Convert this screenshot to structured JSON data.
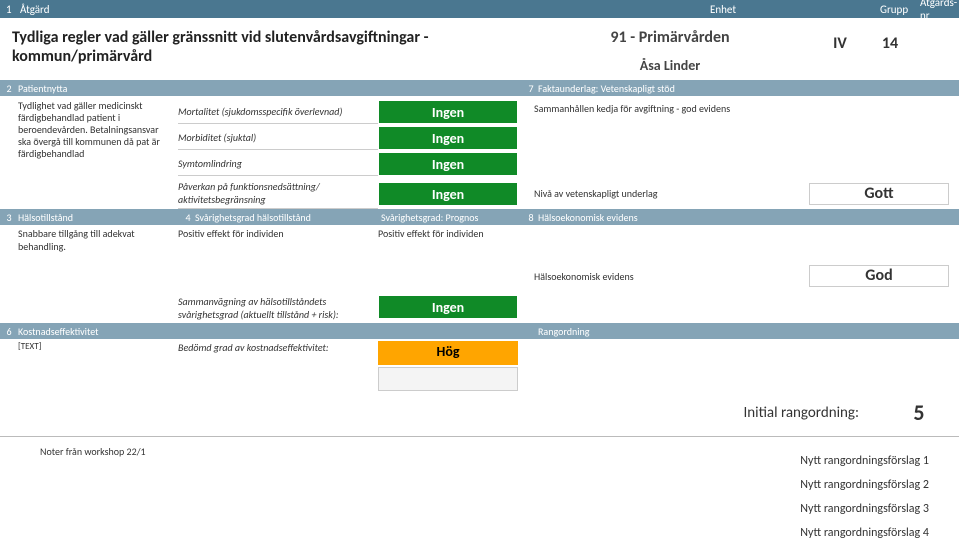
{
  "header": {
    "num": "1",
    "atgard": "Åtgärd",
    "enhet": "Enhet",
    "grupp": "Grupp",
    "atgardsnr": "Åtgärds-nr"
  },
  "title": "Tydliga regler vad gäller gränssnitt vid slutenvårdsavgiftningar - kommun/primärvård",
  "unit": {
    "code_title": "91 - Primärvården",
    "owner": "Åsa Linder",
    "grupp": "IV",
    "nr": "14"
  },
  "bar2": {
    "num": "2",
    "label": "Patientnytta",
    "num7": "7",
    "label7": "Faktaunderlag: Vetenskapligt stöd"
  },
  "sec2": {
    "desc": "Tydlighet vad gäller medicinskt färdigbehandlad patient i beroendevården. Betalningsansvar ska övergå till kommunen då pat är färdigbehandlad",
    "m1": "Mortalitet (sjukdomsspecifik överlevnad)",
    "m2": "Morbiditet (sjuktal)",
    "m3": "Symtomlindring",
    "b1": "Ingen",
    "b2": "Ingen",
    "b3": "Ingen",
    "evidens": "Sammanhållen kedja för avgiftning - god evidens"
  },
  "m4": {
    "label": "Påverkan på funktionsnedsättning/ aktivitetsbegränsning",
    "badge": "Ingen",
    "right_label": "Nivå av vetenskapligt underlag",
    "gott": "Gott"
  },
  "bar3": {
    "num": "3",
    "label": "Hälsotillstånd",
    "num4": "4",
    "label4": "Svårighetsgrad hälsotillstånd",
    "label_prog": "Svårighetsgrad: Prognos",
    "num8": "8",
    "label8": "Hälsoekonomisk evidens"
  },
  "sec3": {
    "left": "Snabbare tillgång till adekvat behandling.",
    "mid1": "Positiv effekt för individen",
    "mid2": "Positiv effekt för individen"
  },
  "god": {
    "label": "Hälsoekonomisk evidens",
    "val": "God"
  },
  "bar5": {
    "label5": "Sammanvägning av hälsotillståndets svårighetsgrad (aktuellt tillstånd + risk):",
    "badge5": "Ingen"
  },
  "bar6": {
    "num": "6",
    "label": "Kostnadseffektivitet",
    "rang": "Rangordning"
  },
  "sec6": {
    "left": "[TEXT]",
    "mid1": "Bedömd grad av kostnadseffektivitet:",
    "hog": "Hög"
  },
  "rank": {
    "label": "Initial rangordning:",
    "val": "5"
  },
  "noter": "Noter från workshop 22/1",
  "nytt": {
    "n1": "Nytt rangordningsförslag 1",
    "n2": "Nytt rangordningsförslag 2",
    "n3": "Nytt rangordningsförslag 3",
    "n4": "Nytt rangordningsförslag 4"
  }
}
